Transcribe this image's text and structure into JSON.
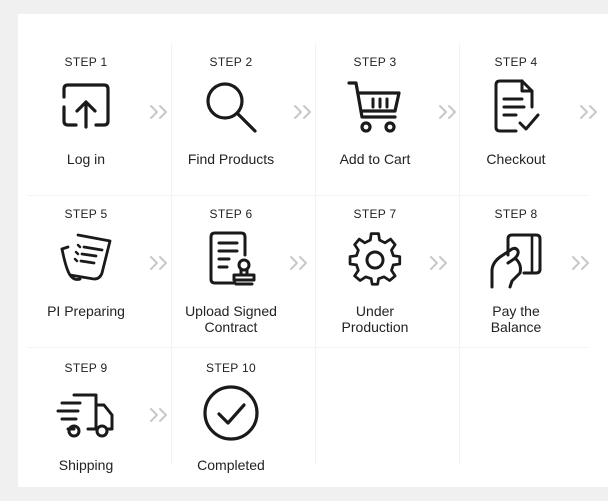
{
  "steps": [
    {
      "num": "STEP 1",
      "label": "Log in",
      "icon": "login-icon"
    },
    {
      "num": "STEP 2",
      "label": "Find Products",
      "icon": "search-icon"
    },
    {
      "num": "STEP 3",
      "label": "Add to Cart",
      "icon": "cart-icon"
    },
    {
      "num": "STEP 4",
      "label": "Checkout",
      "icon": "checkout-document-icon"
    },
    {
      "num": "STEP 5",
      "label": "PI Preparing",
      "icon": "invoice-icon"
    },
    {
      "num": "STEP 6",
      "label": "Upload Signed Contract",
      "icon": "contract-stamp-icon"
    },
    {
      "num": "STEP 7",
      "label": "Under Production",
      "icon": "gear-icon"
    },
    {
      "num": "STEP 8",
      "label": "Pay the Balance",
      "icon": "card-payment-icon"
    },
    {
      "num": "STEP 9",
      "label": "Shipping",
      "icon": "truck-icon"
    },
    {
      "num": "STEP 10",
      "label": "Completed",
      "icon": "check-circle-icon"
    }
  ],
  "arrow_icon": "double-chevron-right-icon",
  "colors": {
    "icon": "#1a1a1a",
    "arrow": "#c8c8c8",
    "background": "#f0f0f0",
    "card": "#ffffff"
  }
}
